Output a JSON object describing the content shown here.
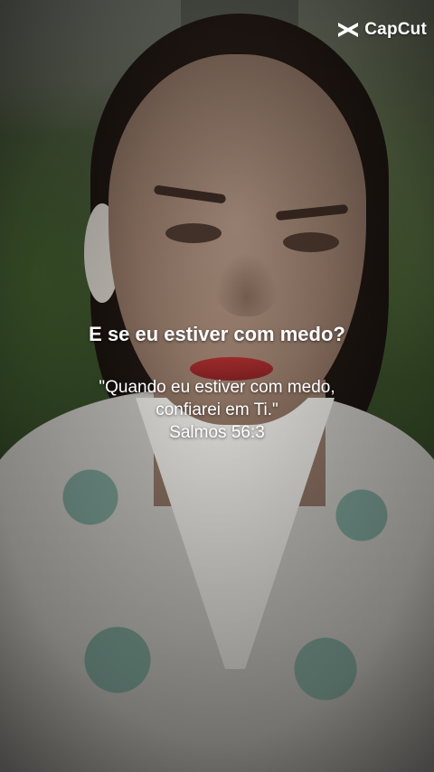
{
  "watermark": {
    "brand": "CapCut",
    "icon": "capcut-logo-icon"
  },
  "caption": {
    "question": "E se eu estiver com medo?",
    "verse_line1": "\"Quando eu estiver com medo,",
    "verse_line2": "confiarei em Ti.\"",
    "reference": "Salmos 56:3"
  },
  "colors": {
    "text": "#ffffff",
    "lips": "#9f2b2b"
  }
}
